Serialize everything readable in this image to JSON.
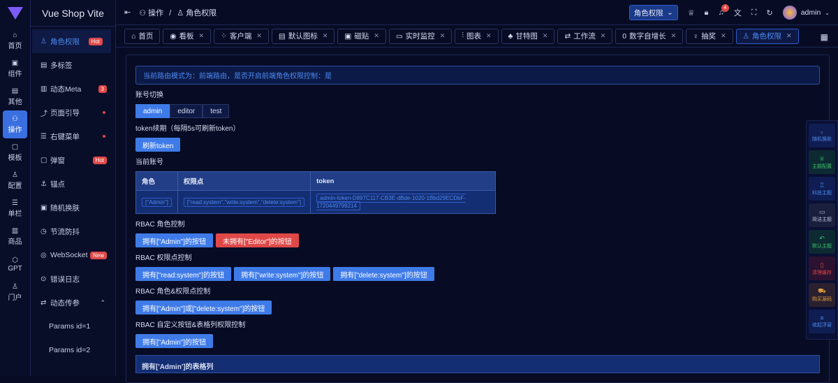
{
  "rail": [
    {
      "icon": "⌂",
      "label": "首页"
    },
    {
      "icon": "▣",
      "label": "组件"
    },
    {
      "icon": "▤",
      "label": "其他"
    },
    {
      "icon": "⚇",
      "label": "操作"
    },
    {
      "icon": "▢",
      "label": "模板"
    },
    {
      "icon": "♙",
      "label": "配置"
    },
    {
      "icon": "☰",
      "label": "单栏"
    },
    {
      "icon": "▥",
      "label": "商品"
    },
    {
      "icon": "⬡",
      "label": "GPT"
    },
    {
      "icon": "♙",
      "label": "门户"
    }
  ],
  "brand": "Vue Shop Vite",
  "menu": [
    {
      "icon": "♙",
      "label": "角色权限",
      "badge": "Hot"
    },
    {
      "icon": "▤",
      "label": "多标签"
    },
    {
      "icon": "▥",
      "label": "动态Meta",
      "badge": "3"
    },
    {
      "icon": "⤴",
      "label": "页面引导",
      "dot": true
    },
    {
      "icon": "☰",
      "label": "右键菜单",
      "dot": true
    },
    {
      "icon": "▢",
      "label": "弹窗",
      "badge": "Hot"
    },
    {
      "icon": "⚓",
      "label": "锚点"
    },
    {
      "icon": "▣",
      "label": "随机换肤"
    },
    {
      "icon": "◷",
      "label": "节流防抖"
    },
    {
      "icon": "◎",
      "label": "WebSocket",
      "badge": "New"
    },
    {
      "icon": "⊙",
      "label": "错误日志"
    },
    {
      "icon": "⇄",
      "label": "动态传参",
      "chevron": "⌃"
    }
  ],
  "submenu": [
    "Params id=1",
    "Params id=2"
  ],
  "breadcrumb": {
    "collapse": "⇤",
    "parent": "操作",
    "sep": "/",
    "current": "角色权限"
  },
  "header": {
    "select": "角色权限",
    "user": "admin",
    "notifications": "4"
  },
  "tabs": [
    {
      "icon": "⌂",
      "label": "首页"
    },
    {
      "icon": "◉",
      "label": "看板"
    },
    {
      "icon": "⁘",
      "label": "客户端"
    },
    {
      "icon": "▤",
      "label": "默认图标"
    },
    {
      "icon": "▣",
      "label": "磁贴"
    },
    {
      "icon": "▭",
      "label": "实时监控"
    },
    {
      "icon": "⫶",
      "label": "图表"
    },
    {
      "icon": "♣",
      "label": "甘特图"
    },
    {
      "icon": "⇄",
      "label": "工作流"
    },
    {
      "icon": "0",
      "label": "数字自增长"
    },
    {
      "icon": "♀",
      "label": "抽奖"
    },
    {
      "icon": "♙",
      "label": "角色权限",
      "active": true
    }
  ],
  "alert": "当前路由模式为：前端路由，是否开启前端角色权限控制：是",
  "account_switch": {
    "label": "账号切换",
    "options": [
      "admin",
      "editor",
      "test"
    ],
    "selected": "admin"
  },
  "token_renew": {
    "label": "token续期（每隔5s可刷新token）",
    "button": "刷新token"
  },
  "current_account": {
    "label": "当前账号",
    "headers": [
      "角色",
      "权限点",
      "token"
    ],
    "row": [
      "[\"Admin\"]",
      "[\"read:system\",\"write:system\",\"delete:system\"]",
      "admin-token-D897C117-CB3E-dBde-1020-1Bbd29ECDbF-1720449799214"
    ]
  },
  "rbac_role": {
    "label": "RBAC 角色控制",
    "buttons": [
      "拥有[\"Admin\"]的按钮",
      "未拥有[\"Editor\"]的按钮"
    ]
  },
  "rbac_perm": {
    "label": "RBAC 权限点控制",
    "buttons": [
      "拥有[\"read:system\"]的按钮",
      "拥有[\"write:system\"]的按钮",
      "拥有[\"delete:system\"]的按钮"
    ]
  },
  "rbac_mix": {
    "label": "RBAC 角色&权限点控制",
    "button": "拥有[\"Admin\"]或[\"delete:system\"]的按钮"
  },
  "rbac_custom": {
    "label": "RBAC 自定义按钮&表格列权限控制",
    "button": "拥有[\"Admin\"]的按钮"
  },
  "table_col_header": "拥有['Admin']的表格列",
  "float": [
    {
      "icon": "♁",
      "label": "随机换肤",
      "color": "#4d8af0",
      "bg": "#0f1d52"
    },
    {
      "icon": "♕",
      "label": "主题配置",
      "color": "#3cc46b",
      "bg": "#0d2a33"
    },
    {
      "icon": "♖",
      "label": "科技主题",
      "color": "#4d8af0",
      "bg": "#0f1d52"
    },
    {
      "icon": "▭",
      "label": "简洁主题",
      "color": "#b8bfd8",
      "bg": "#1a1f3e"
    },
    {
      "icon": "↶",
      "label": "默认主题",
      "color": "#3cc46b",
      "bg": "#0d2a33"
    },
    {
      "icon": "▯",
      "label": "清理缓存",
      "color": "#e04848",
      "bg": "#2a1230"
    },
    {
      "icon": "⛟",
      "label": "购买源码",
      "color": "#e5a03c",
      "bg": "#2a2030"
    },
    {
      "icon": "≡",
      "label": "收起浮窗",
      "color": "#4d8af0",
      "bg": "#0f1d52"
    }
  ]
}
